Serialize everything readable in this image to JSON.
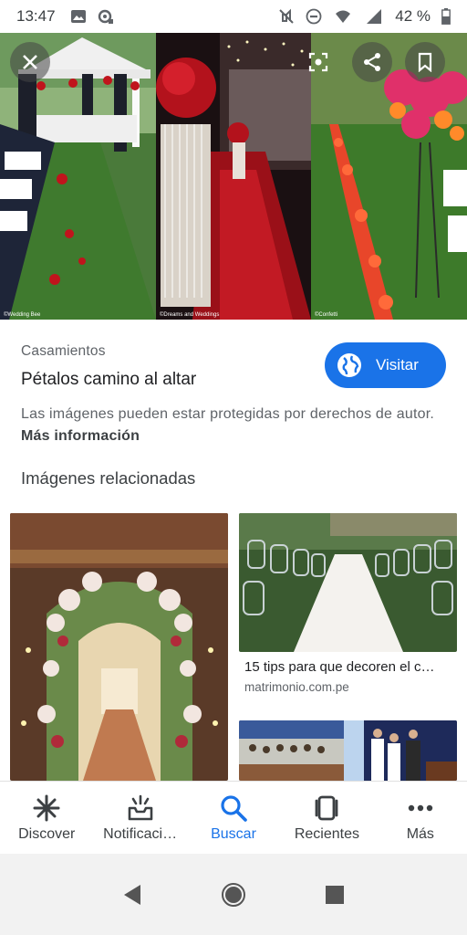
{
  "status_bar": {
    "time": "13:47",
    "battery": "42 %",
    "icons": [
      "image-icon",
      "sync-icon",
      "mute-icon",
      "dnd-icon",
      "wifi-icon",
      "signal-icon",
      "battery-icon"
    ]
  },
  "hero": {
    "watermarks": [
      "©Wedding Bee",
      "©Dreams and Weddings",
      "©Confetti"
    ],
    "buttons": [
      "close-icon",
      "lens-icon",
      "share-icon",
      "bookmark-icon"
    ]
  },
  "result": {
    "source": "Casamientos",
    "title": "Pétalos camino al altar",
    "visit_label": "Visitar",
    "copyright_text": "Las imágenes pueden estar protegidas por derechos de autor.",
    "more_info": "Más información"
  },
  "related": {
    "heading": "Imágenes relacionadas",
    "items": [
      {
        "caption": "15 tips para que decoren el c…",
        "domain": "matrimonio.com.pe"
      }
    ]
  },
  "bottom_nav": {
    "items": [
      {
        "label": "Discover",
        "icon": "asterisk-icon"
      },
      {
        "label": "Notificaci…",
        "icon": "notifications-icon"
      },
      {
        "label": "Buscar",
        "icon": "search-icon"
      },
      {
        "label": "Recientes",
        "icon": "recents-icon"
      },
      {
        "label": "Más",
        "icon": "more-icon"
      }
    ],
    "active_index": 2
  },
  "colors": {
    "accent": "#1a73e8",
    "text_primary": "#202124",
    "text_secondary": "#5f6368"
  }
}
